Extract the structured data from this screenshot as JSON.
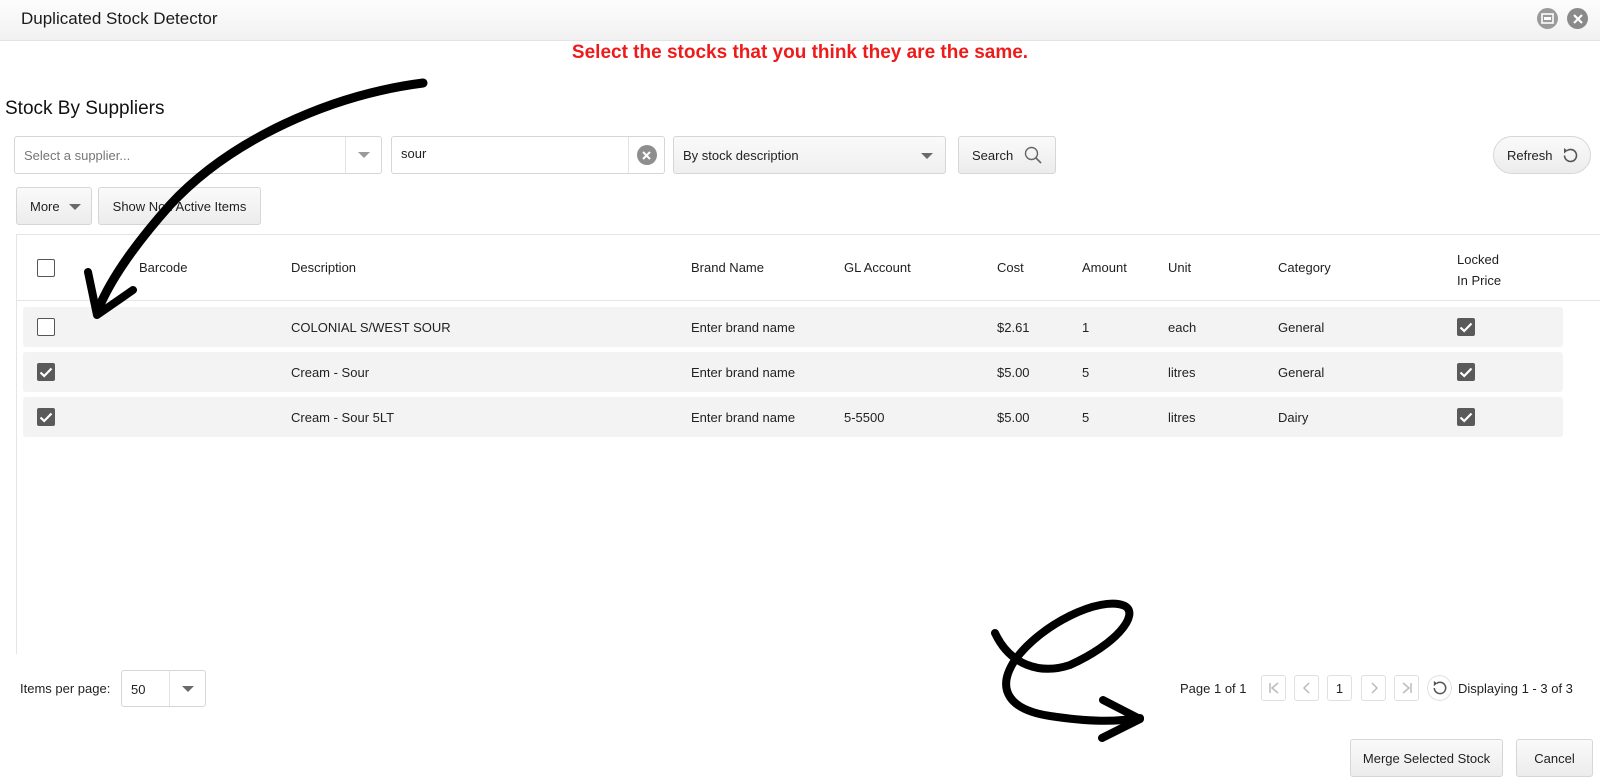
{
  "window": {
    "title": "Duplicated Stock Detector"
  },
  "instruction": "Select the stocks that you think they are the same.",
  "section_title": "Stock By Suppliers",
  "filters": {
    "supplier_placeholder": "Select a supplier...",
    "search_value": "sour",
    "search_mode": "By stock description",
    "search_label": "Search",
    "refresh_label": "Refresh",
    "more_label": "More",
    "show_non_active_label": "Show Non Active Items"
  },
  "table": {
    "columns": {
      "barcode": "Barcode",
      "description": "Description",
      "brand": "Brand Name",
      "gl": "GL Account",
      "cost": "Cost",
      "amount": "Amount",
      "unit": "Unit",
      "category": "Category",
      "locked_line1": "Locked",
      "locked_line2": "In Price"
    },
    "rows": [
      {
        "selected": false,
        "barcode": "",
        "description": "COLONIAL S/WEST SOUR",
        "brand": "Enter brand name",
        "gl": "",
        "cost": "$2.61",
        "amount": "1",
        "unit": "each",
        "category": "General",
        "locked": true
      },
      {
        "selected": true,
        "barcode": "",
        "description": "Cream - Sour",
        "brand": "Enter brand name",
        "gl": "",
        "cost": "$5.00",
        "amount": "5",
        "unit": "litres",
        "category": "General",
        "locked": true
      },
      {
        "selected": true,
        "barcode": "",
        "description": "Cream - Sour 5LT",
        "brand": "Enter brand name",
        "gl": "5-5500",
        "cost": "$5.00",
        "amount": "5",
        "unit": "litres",
        "category": "Dairy",
        "locked": true
      }
    ]
  },
  "pager": {
    "items_per_page_label": "Items per page:",
    "items_per_page": "50",
    "page_info": "Page 1 of 1",
    "current_page": "1",
    "displaying": "Displaying 1 - 3 of 3"
  },
  "actions": {
    "merge_label": "Merge Selected Stock",
    "cancel_label": "Cancel"
  },
  "colors": {
    "instruction": "#ee1b1b",
    "checkbox_checked": "#5a5a5a",
    "row_bg": "#f3f3f3"
  }
}
